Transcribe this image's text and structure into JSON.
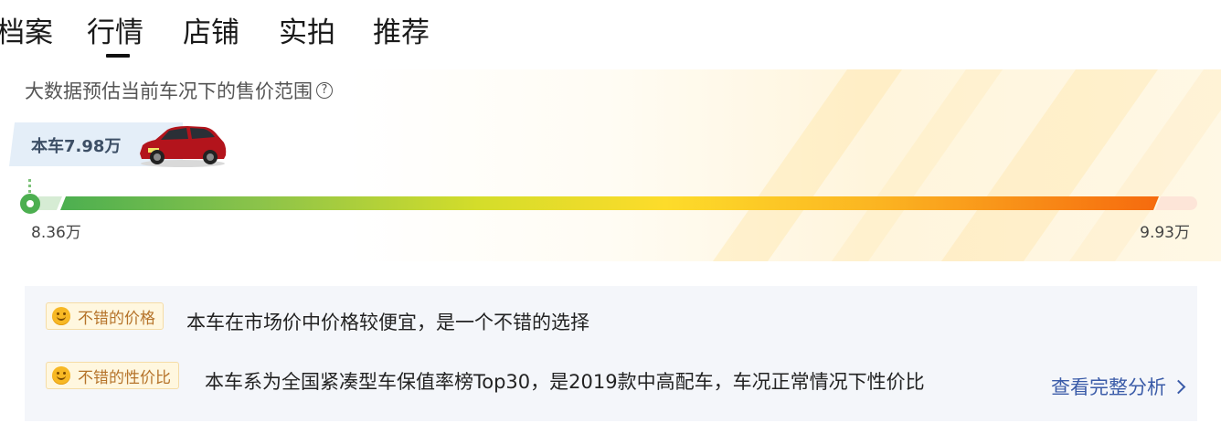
{
  "tabs": [
    {
      "label": "档案",
      "active": false
    },
    {
      "label": "行情",
      "active": true
    },
    {
      "label": "店铺",
      "active": false
    },
    {
      "label": "实拍",
      "active": false
    },
    {
      "label": "推荐",
      "active": false
    }
  ],
  "valuation": {
    "subtitle": "大数据预估当前车况下的售价范围",
    "help_icon": "question-circle-icon",
    "current_price_label": "本车7.98万",
    "current_price_fraction": -0.24,
    "range_min": "8.36万",
    "range_max": "9.93万",
    "car_color": "#b3141c"
  },
  "analysis": {
    "rows": [
      {
        "tag": "不错的价格",
        "text": "本车在市场价中价格较便宜，是一个不错的选择"
      },
      {
        "tag": "不错的性价比",
        "text": "本车系为全国紧凑型车保值率榜Top30，是2019款中高配车，车况正常情况下性价比"
      }
    ],
    "view_full_label": "查看完整分析"
  },
  "colors": {
    "bar_start": "#4caf50",
    "bar_mid": "#fddc2a",
    "bar_end": "#f66a0e",
    "link": "#3a5ba8",
    "tag_text": "#b5732a"
  }
}
